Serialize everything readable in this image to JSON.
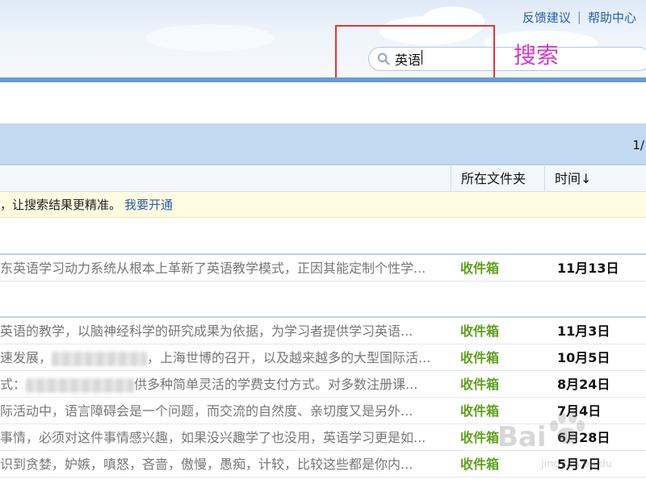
{
  "header": {
    "links": [
      "反馈建议",
      "帮助中心"
    ],
    "separator": "|",
    "search": {
      "value": "英语"
    },
    "annotation": "搜索",
    "annotation_color": "#d23cc8",
    "highlight_color": "#e33636"
  },
  "toolbar": {
    "page_indicator": "1/"
  },
  "columns": {
    "folder": "所在文件夹",
    "time": "时间↓"
  },
  "notice": {
    "text": "，让搜索结果更精准。",
    "link": "我要开通"
  },
  "rows": [
    {
      "subject": "东英语学习动力系统从根本上革新了英语教学模式，正因其能定制个性学...",
      "folder": "收件箱",
      "time": "11月13日"
    },
    {
      "subject": "英语的教学，以脑神经科学的研究成果为依据，为学习者提供学习英语...",
      "folder": "收件箱",
      "time": "11月3日"
    },
    {
      "subject_pre": "速发展，",
      "subject_post": "，上海世博的召开，以及越来越多的大型国际活...",
      "folder": "收件箱",
      "time": "10月5日"
    },
    {
      "subject_pre": "式：",
      "subject_post": "供多种简单灵活的学费支付方式。对多数注册课...",
      "folder": "收件箱",
      "time": "8月24日"
    },
    {
      "subject": "际活动中，语言障碍会是一个问题，而交流的自然度、亲切度又是另外...",
      "folder": "收件箱",
      "time": "7月4日"
    },
    {
      "subject": "事情，必须对这件事情感兴趣，如果没兴趣学了也没用，英语学习更是如...",
      "folder": "收件箱",
      "time": "6月28日"
    },
    {
      "subject": "识到贪婪，妒嫉，嗔怒，吝啬，傲慢，愚痴，计较，比较这些都是你内...",
      "folder": "收件箱",
      "time": "5月7日"
    }
  ],
  "folder_color": "#5fa01f",
  "watermark": {
    "text": "Bai",
    "sub": "jingyan.baidu"
  }
}
